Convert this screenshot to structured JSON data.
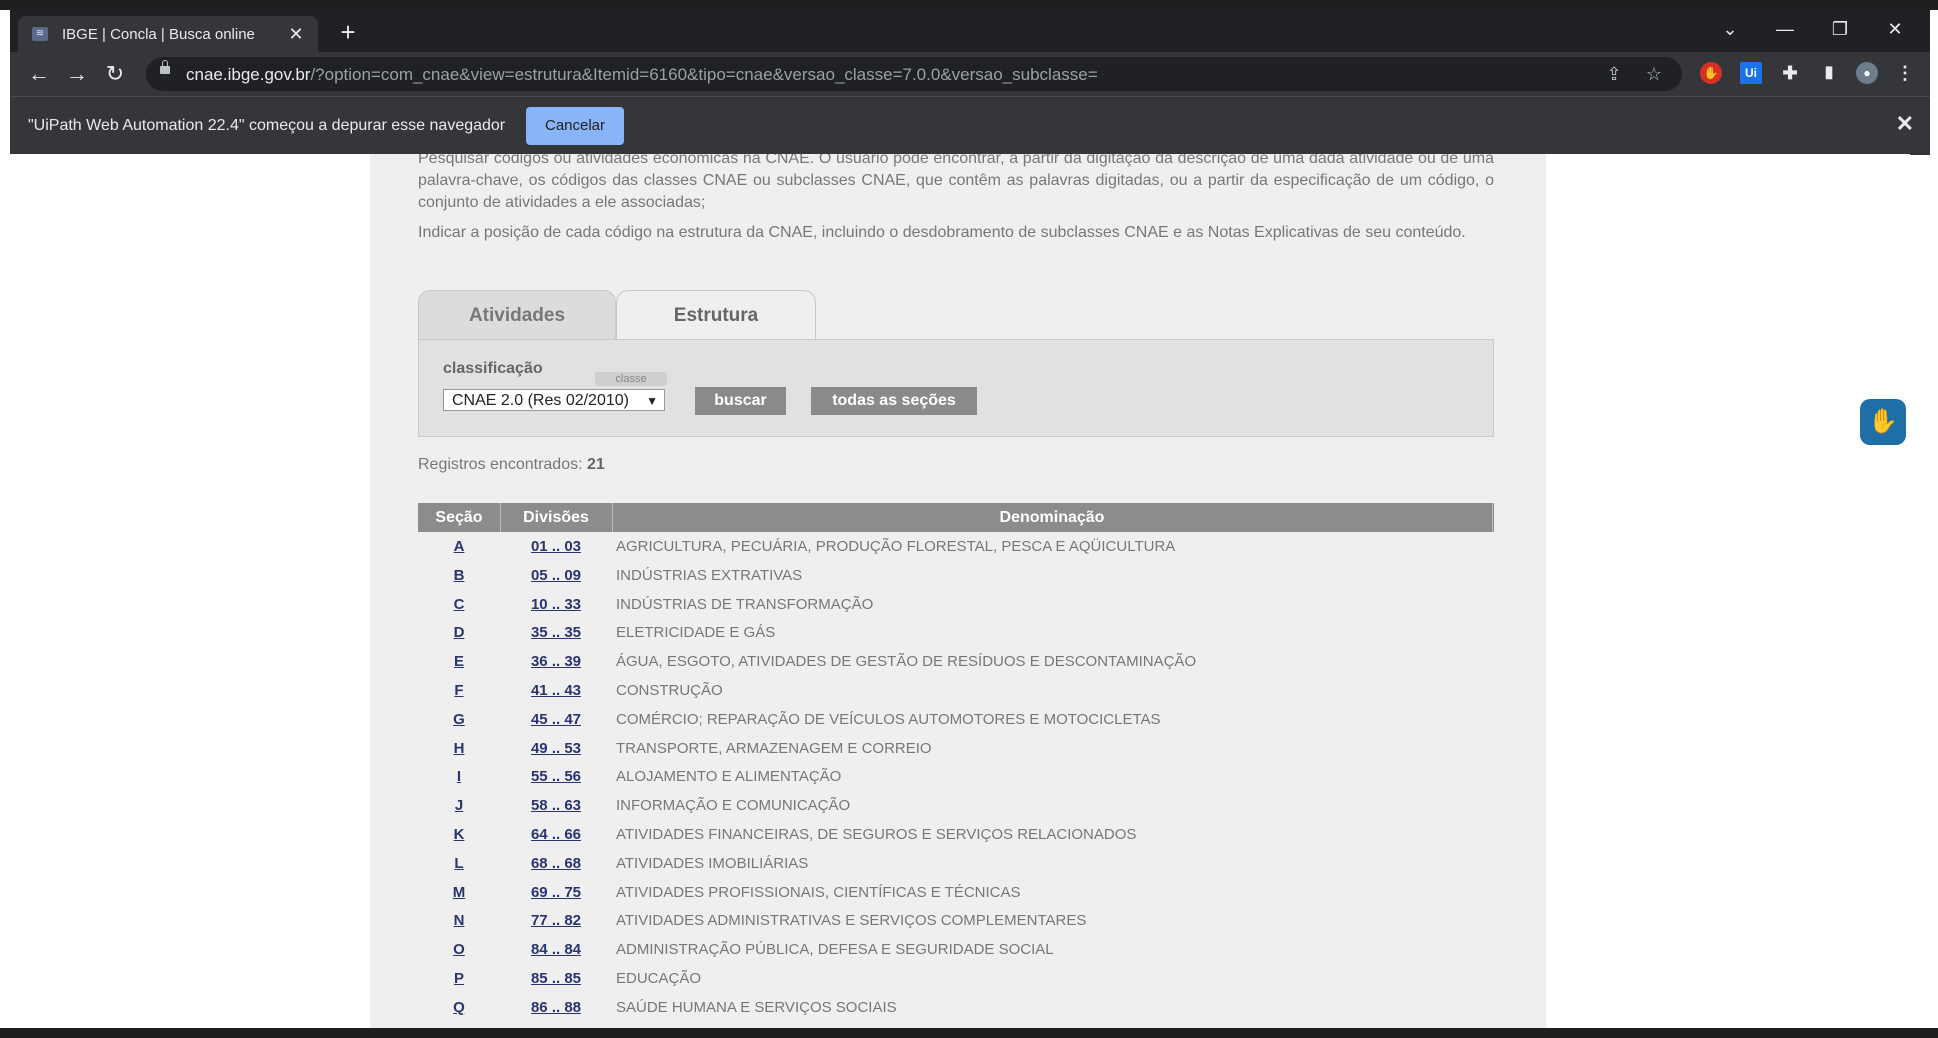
{
  "browser": {
    "tab_title": "IBGE | Concla | Busca online",
    "url_host": "cnae.ibge.gov.br",
    "url_rest": "/?option=com_cnae&view=estrutura&Itemid=6160&tipo=cnae&versao_classe=7.0.0&versao_subclasse="
  },
  "infobar": {
    "message": "\"UiPath Web Automation 22.4\" começou a depurar esse navegador",
    "cancel_label": "Cancelar"
  },
  "intro": {
    "line1": "Pesquisar códigos ou atividades econômicas na CNAE. O usuário pode encontrar, a partir da digitação da descrição de uma dada atividade ou de uma palavra-chave, os códigos das classes CNAE ou subclasses CNAE, que contêm as palavras digitadas, ou a partir da especificação de um código, o conjunto de atividades a ele associadas;",
    "line2": "Indicar a posição de cada código na estrutura da CNAE, incluindo o desdobramento de subclasses CNAE e as Notas Explicativas de seu conteúdo."
  },
  "tabs": {
    "atividades": "Atividades",
    "estrutura": "Estrutura"
  },
  "form": {
    "label": "classificação",
    "classe_tag": "classe",
    "select_value": "CNAE 2.0 (Res 02/2010)",
    "buscar": "buscar",
    "todas": "todas as seções"
  },
  "results": {
    "label": "Registros encontrados: ",
    "count": "21"
  },
  "table": {
    "headers": {
      "secao": "Seção",
      "divisoes": "Divisões",
      "denominacao": "Denominação"
    },
    "rows": [
      {
        "sec": "A",
        "div": "01 .. 03",
        "den": "AGRICULTURA, PECUÁRIA, PRODUÇÃO FLORESTAL, PESCA E AQÜICULTURA"
      },
      {
        "sec": "B",
        "div": "05 .. 09",
        "den": "INDÚSTRIAS EXTRATIVAS"
      },
      {
        "sec": "C",
        "div": "10 .. 33",
        "den": "INDÚSTRIAS DE TRANSFORMAÇÃO"
      },
      {
        "sec": "D",
        "div": "35 .. 35",
        "den": "ELETRICIDADE E GÁS"
      },
      {
        "sec": "E",
        "div": "36 .. 39",
        "den": "ÁGUA, ESGOTO, ATIVIDADES DE GESTÃO DE RESÍDUOS E DESCONTAMINAÇÃO"
      },
      {
        "sec": "F",
        "div": "41 .. 43",
        "den": "CONSTRUÇÃO"
      },
      {
        "sec": "G",
        "div": "45 .. 47",
        "den": "COMÉRCIO; REPARAÇÃO DE VEÍCULOS AUTOMOTORES E MOTOCICLETAS"
      },
      {
        "sec": "H",
        "div": "49 .. 53",
        "den": "TRANSPORTE, ARMAZENAGEM E CORREIO"
      },
      {
        "sec": "I",
        "div": "55 .. 56",
        "den": "ALOJAMENTO E ALIMENTAÇÃO"
      },
      {
        "sec": "J",
        "div": "58 .. 63",
        "den": "INFORMAÇÃO E COMUNICAÇÃO"
      },
      {
        "sec": "K",
        "div": "64 .. 66",
        "den": "ATIVIDADES FINANCEIRAS, DE SEGUROS E SERVIÇOS RELACIONADOS"
      },
      {
        "sec": "L",
        "div": "68 .. 68",
        "den": "ATIVIDADES IMOBILIÁRIAS"
      },
      {
        "sec": "M",
        "div": "69 .. 75",
        "den": "ATIVIDADES PROFISSIONAIS, CIENTÍFICAS E TÉCNICAS"
      },
      {
        "sec": "N",
        "div": "77 .. 82",
        "den": "ATIVIDADES ADMINISTRATIVAS E SERVIÇOS COMPLEMENTARES"
      },
      {
        "sec": "O",
        "div": "84 .. 84",
        "den": "ADMINISTRAÇÃO PÚBLICA, DEFESA E SEGURIDADE SOCIAL"
      },
      {
        "sec": "P",
        "div": "85 .. 85",
        "den": "EDUCAÇÃO"
      },
      {
        "sec": "Q",
        "div": "86 .. 88",
        "den": "SAÚDE HUMANA E SERVIÇOS SOCIAIS"
      }
    ]
  }
}
